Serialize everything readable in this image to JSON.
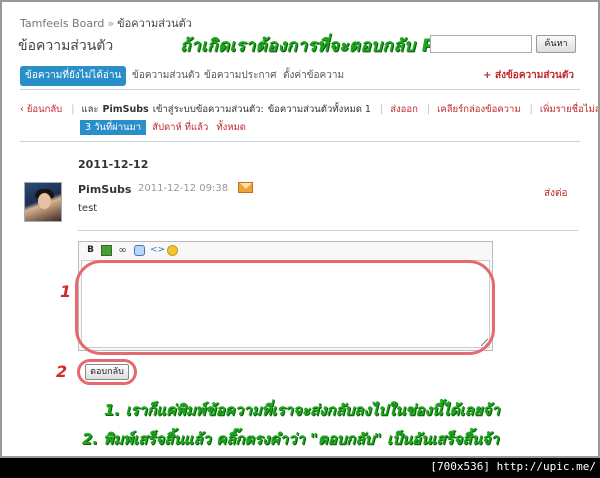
{
  "breadcrumb": {
    "home": "Tamfeels Board",
    "separator": "»",
    "current": "ข้อความส่วนตัว"
  },
  "page_title": "ข้อความส่วนตัว",
  "overlay_title": "ถ้าเกิดเราต้องการที่จะตอบกลับ PM",
  "search": {
    "value": "",
    "button_label": "ค้นหา"
  },
  "tabs": [
    {
      "label": "ข้อความที่ยังไม่ได้อ่าน",
      "active": true
    },
    {
      "label": "ข้อความส่วนตัว"
    },
    {
      "label": "ข้อความประกาศ"
    },
    {
      "label": "ตั้งค่าข้อความ"
    }
  ],
  "new_message_label": "+ ส่งข้อความส่วนตัว",
  "toolbar": {
    "back": "‹ ย้อนกลับ",
    "joined": "และ",
    "user": "PimSubs",
    "joined_text": "เข้าสู่ระบบข้อความส่วนตัว:",
    "total_label": "ข้อความส่วนตัวทั้งหมด 1",
    "send_out": "ส่งออก",
    "clear_inbox": "เคลียร์กล่องข้อความ",
    "blocklist": "เพิ่มรายชื่อไม่สนใจ"
  },
  "time_filters": [
    "3 วันที่ผ่านมา",
    "สัปดาห์ ที่แล้ว",
    "ทั้งหมด"
  ],
  "message": {
    "date": "2011-12-12",
    "sender": "PimSubs",
    "time": "2011-12-12 09:38",
    "forward": "ส่งต่อ",
    "body": "test"
  },
  "editor": {
    "tools": [
      "B",
      "",
      "∞",
      "",
      "<>",
      ""
    ],
    "text": ""
  },
  "reply_button": "ตอบกลับ",
  "markers": {
    "one": "1",
    "two": "2"
  },
  "instructions": [
    "1. เราก็แค่พิมพ์ข้อความที่เราจะส่งกลับลงไปในช่องนี้ได้เลยจ้า",
    "2. พิมพ์เสร็จสิ้นแล้ว คลิ๊กตรงคำว่า \"ตอบกลับ\" เป็นอันเสร็จสิ้นจ้า"
  ],
  "watermark": "[700x536] http://upic.me/",
  "colors": {
    "accent": "#2a8fc9",
    "link": "#c0282c",
    "annotation_green": "#1fa81f",
    "annotation_red": "#e46a70"
  }
}
